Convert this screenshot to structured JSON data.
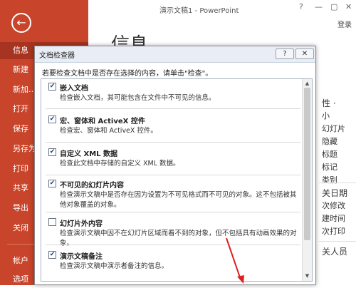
{
  "window": {
    "title": "演示文稿1 - PowerPoint",
    "controls": [
      "?",
      "—",
      "▢",
      "✕"
    ],
    "login": "登录"
  },
  "backstage": {
    "back_icon": "back-arrow-icon",
    "nav": [
      {
        "label": "信息",
        "active": true
      },
      {
        "label": "新建",
        "active": false
      },
      {
        "label": "新加…",
        "active": false
      },
      {
        "label": "打开",
        "active": false
      },
      {
        "label": "保存",
        "active": false
      },
      {
        "label": "另存为",
        "active": false
      },
      {
        "label": "打印",
        "active": false
      },
      {
        "label": "共享",
        "active": false
      },
      {
        "label": "导出",
        "active": false
      },
      {
        "label": "关闭",
        "active": false
      },
      {
        "label": "帐户",
        "active": false
      },
      {
        "label": "选项",
        "active": false
      }
    ],
    "heading": "信息",
    "right_fragments": [
      "性 ·",
      "小",
      "幻灯片",
      "隐藏",
      "标题",
      "标记",
      "类别",
      "关日期",
      "次修改",
      "建时间",
      "次打印",
      "关人员"
    ]
  },
  "dialog": {
    "title": "文档检查器",
    "help_label": "?",
    "close_label": "✕",
    "instruction": "若要检查文档中是否存在选择的内容，请单击\"检查\"。",
    "items": [
      {
        "checked": true,
        "title": "嵌入文档",
        "desc": "检查嵌入文档，其可能包含在文件中不可见的信息。"
      },
      {
        "checked": true,
        "title": "宏、窗体和 ActiveX 控件",
        "desc": "检查宏、窗体和 ActiveX 控件。"
      },
      {
        "checked": true,
        "title": "自定义 XML 数据",
        "desc": "检查此文档中存储的自定义 XML 数据。"
      },
      {
        "checked": true,
        "title": "不可见的幻灯片内容",
        "desc": "检查演示文稿中是否存在因为设置为不可见格式而不可见的对象。这不包括被其他对象覆盖的对象。"
      },
      {
        "checked": false,
        "title": "幻灯片外内容",
        "desc": "检查演示文稿中因不在幻灯片区域而看不到的对象，但不包括具有动画效果的对象。"
      },
      {
        "checked": true,
        "title": "演示文稿备注",
        "desc": "检查演示文稿中演示者备注的信息。"
      }
    ]
  },
  "colors": {
    "accent": "#c8442a",
    "accent_active": "#a73420",
    "annotation": "#e02020"
  }
}
